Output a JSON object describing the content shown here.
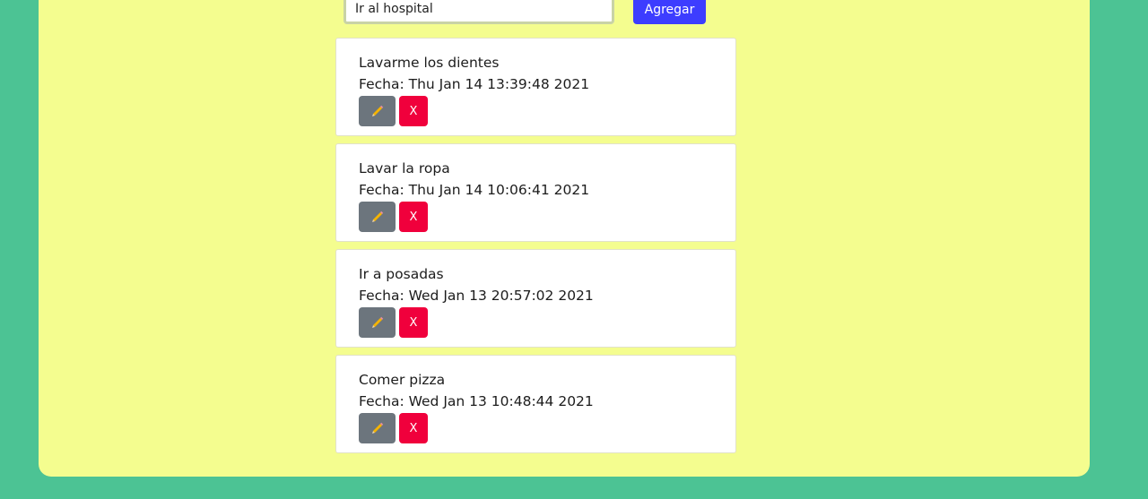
{
  "form": {
    "input_value": "Ir al hospital",
    "add_label": "Agregar"
  },
  "tasks": [
    {
      "title": "Lavarme los dientes",
      "date": "Fecha: Thu Jan 14 13:39:48 2021",
      "delete_label": "X"
    },
    {
      "title": "Lavar la ropa",
      "date": "Fecha: Thu Jan 14 10:06:41 2021",
      "delete_label": "X"
    },
    {
      "title": "Ir a posadas",
      "date": "Fecha: Wed Jan 13 20:57:02 2021",
      "delete_label": "X"
    },
    {
      "title": "Comer pizza",
      "date": "Fecha: Wed Jan 13 10:48:44 2021",
      "delete_label": "X"
    }
  ],
  "icons": {
    "edit": "pencil-icon"
  },
  "colors": {
    "background": "#4cc394",
    "panel": "#f4fd8f",
    "add_button": "#3d3dff",
    "edit_button": "#6c757d",
    "delete_button": "#f0003c"
  }
}
